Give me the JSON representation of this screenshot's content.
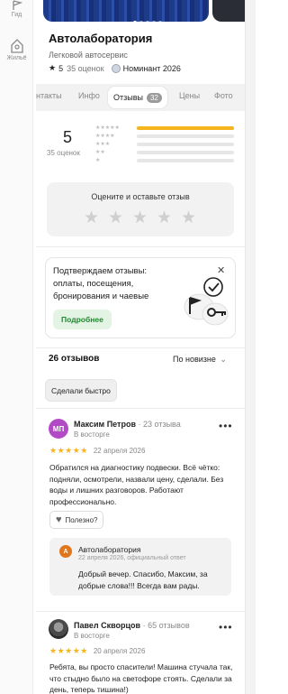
{
  "rail": {
    "items": [
      {
        "label": "Гид",
        "icon": "flag-icon"
      },
      {
        "label": "Жильё",
        "icon": "house-icon"
      }
    ]
  },
  "place": {
    "title": "Автолаборатория",
    "category": "Легковой автосервис",
    "rating": "5",
    "rating_count": "35 оценок",
    "nominee": "Номинант 2026",
    "photo_count_dots": 5
  },
  "tabs": [
    {
      "label": "нтакты"
    },
    {
      "label": "Инфо"
    },
    {
      "label": "Отзывы",
      "badge": "32",
      "active": true
    },
    {
      "label": "Цены"
    },
    {
      "label": "Фото"
    }
  ],
  "rating_summary": {
    "score": "5",
    "count_label": "35 оценок",
    "distribution": [
      {
        "stars": 5,
        "fraction": 1.0
      },
      {
        "stars": 4,
        "fraction": 0
      },
      {
        "stars": 3,
        "fraction": 0
      },
      {
        "stars": 2,
        "fraction": 0
      },
      {
        "stars": 1,
        "fraction": 0
      }
    ],
    "bar_color": "#f6b51e"
  },
  "rate_prompt": {
    "label": "Оцените и оставьте отзыв",
    "stars": 5
  },
  "promo": {
    "text": "Подтверждаем отзывы: оплаты, посещения, бронирования и чаевые",
    "button": "Подробнее",
    "close": "✕"
  },
  "reviews_header": {
    "title": "26 отзывов",
    "sort": "По новизне"
  },
  "filter_chip": "Сделали быстро",
  "reviews": [
    {
      "initials": "МП",
      "avatar_color": "#b24ac6",
      "name": "Максим Петров",
      "count": "· 23 отзыва",
      "status": "В восторге",
      "stars": 5,
      "date": "22 апреля 2026",
      "text": "Обратился на диагностику подвески. Всё чётко: подняли, осмотрели, назвали цену, сделали. Без воды и лишних разговоров. Работают профессионально.",
      "useful_label": "Полезно?",
      "reply": {
        "initial": "А",
        "org_name": "Автолаборатория",
        "meta": "22 апреля 2026, официальный ответ",
        "text": "Добрый вечер. Спасибо, Максим, за добрые слова!!! Всегда вам рады."
      }
    },
    {
      "initials": "",
      "name": "Павел Скворцов",
      "count": "· 65 отзывов",
      "status": "В восторге",
      "stars": 5,
      "date": "20 апреля 2026",
      "text": "Ребята, вы просто спасители! Машина стучала так, что стыдно было на светофоре стоять. Сделали за день, теперь тишина!)"
    }
  ],
  "icons": {
    "more": "more-dots-icon",
    "heart": "heart-icon",
    "chevron": "chevron-down-icon",
    "star": "star-icon"
  }
}
